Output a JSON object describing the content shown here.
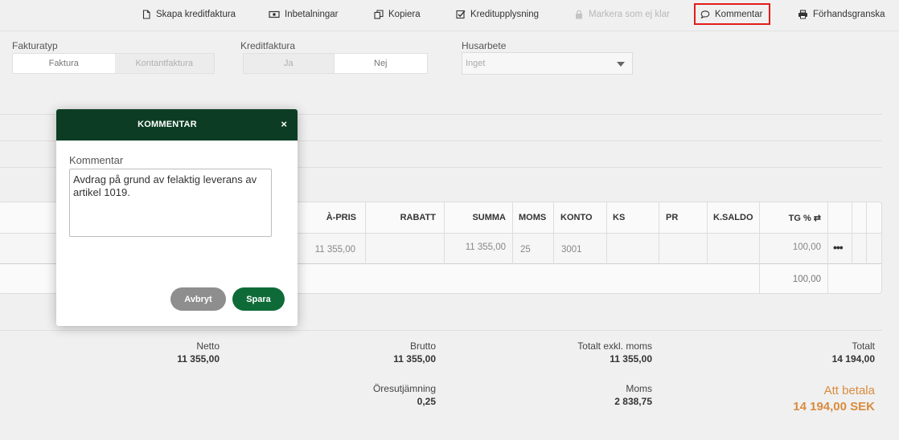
{
  "toolbar": {
    "items": [
      {
        "label": "Skapa kreditfaktura",
        "icon": "document-icon"
      },
      {
        "label": "Inbetalningar",
        "icon": "money-icon"
      },
      {
        "label": "Kopiera",
        "icon": "copy-icon"
      },
      {
        "label": "Kreditupplysning",
        "icon": "checkbox-icon"
      },
      {
        "label": "Markera som ej klar",
        "icon": "lock-icon",
        "disabled": true
      },
      {
        "label": "Kommentar",
        "icon": "comment-icon",
        "highlighted": true
      },
      {
        "label": "Förhandsgranska",
        "icon": "printer-icon"
      }
    ]
  },
  "form": {
    "fakturatyp": {
      "label": "Fakturatyp",
      "options": [
        "Faktura",
        "Kontantfaktura"
      ],
      "selected": "Faktura"
    },
    "kreditfaktura": {
      "label": "Kreditfaktura",
      "options": [
        "Ja",
        "Nej"
      ],
      "selected": "Nej"
    },
    "husarbete": {
      "label": "Husarbete",
      "value": "Inget"
    }
  },
  "table": {
    "headers": {
      "apris": "À-PRIS",
      "rabatt": "RABATT",
      "summa": "SUMMA",
      "moms": "MOMS",
      "konto": "KONTO",
      "ks": "KS",
      "pr": "PR",
      "ksaldo": "K.SALDO",
      "tg": "TG % ⇄"
    },
    "row": {
      "apris": "11 355,00",
      "rabatt": "",
      "summa": "11 355,00",
      "moms": "25",
      "konto": "3001",
      "tg": "100,00",
      "menu": "•••"
    },
    "footer_tg": "100,00"
  },
  "totals": {
    "netto_label": "Netto",
    "netto_value": "11 355,00",
    "brutto_label": "Brutto",
    "brutto_value": "11 355,00",
    "exkl_label": "Totalt exkl. moms",
    "exkl_value": "11 355,00",
    "totalt_label": "Totalt",
    "totalt_value": "14 194,00",
    "ore_label": "Öresutjämning",
    "ore_value": "0,25",
    "moms_label": "Moms",
    "moms_value": "2 838,75",
    "att_betala_label": "Att betala",
    "att_betala_value": "14 194,00 SEK"
  },
  "modal": {
    "title": "KOMMENTAR",
    "close": "×",
    "field_label": "Kommentar",
    "comment": "Avdrag på grund av felaktig leverans av artikel 1019.",
    "cancel_label": "Avbryt",
    "save_label": "Spara"
  },
  "colors": {
    "modal_header": "#0c3d24",
    "save_button": "#0e6b38",
    "cancel_button": "#8e8e8e",
    "highlight_border": "#e31b1b",
    "pay_accent": "#d98b3e"
  }
}
